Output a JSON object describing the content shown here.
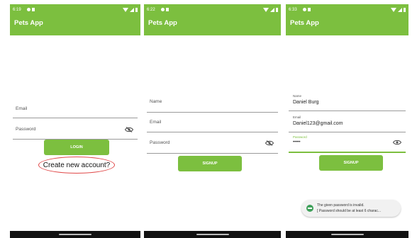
{
  "colors": {
    "accent": "#7cbf3f",
    "link_highlight": "#e04848"
  },
  "screens": [
    {
      "status_time": "6:19",
      "app_title": "Pets App",
      "email_placeholder": "Email",
      "password_placeholder": "Password",
      "login_label": "LOGIN",
      "create_account_label": "Create new account?"
    },
    {
      "status_time": "6:22",
      "app_title": "Pets App",
      "name_placeholder": "Name",
      "email_placeholder": "Email",
      "password_placeholder": "Password",
      "signup_label": "SIGNUP"
    },
    {
      "status_time": "6:33",
      "app_title": "Pets App",
      "name_label": "Name",
      "name_value": "Daniel Burg",
      "email_label": "Email",
      "email_value": "Daniel123@gmail.com",
      "password_label": "Password",
      "password_value": "•••••",
      "signup_label": "SIGNUP",
      "toast_line1": "The given password is invalid.",
      "toast_line2": "[ Password should be at least 6 charac..."
    }
  ],
  "icons": {
    "visibility_off": "eye-off-icon",
    "visibility_on": "eye-icon",
    "toast": "app-icon"
  }
}
